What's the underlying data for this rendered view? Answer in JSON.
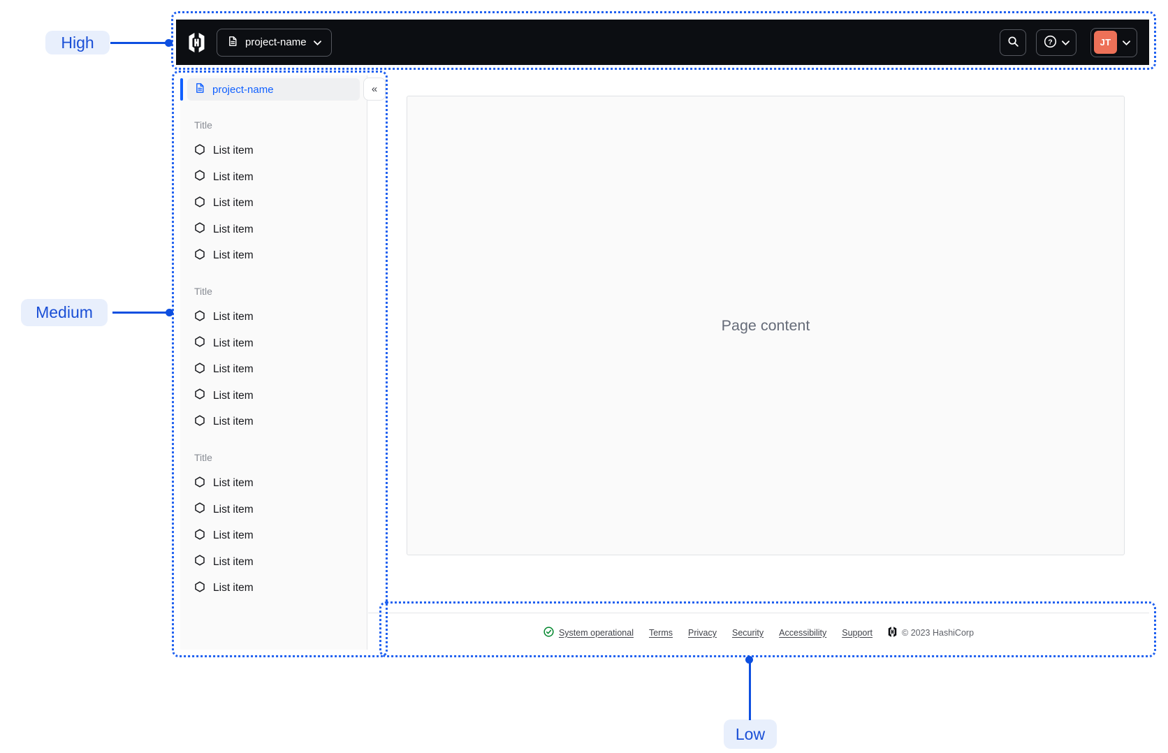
{
  "annotations": {
    "high": {
      "label": "High"
    },
    "medium": {
      "label": "Medium"
    },
    "low": {
      "label": "Low"
    }
  },
  "navbar": {
    "logo": "hashicorp-logo",
    "project_switcher": {
      "icon": "document-icon",
      "label": "project-name",
      "chevron": "chevron-down-icon"
    },
    "search_button": {
      "icon": "search-icon"
    },
    "help_menu": {
      "icon": "help-icon",
      "glyph": "?",
      "chevron": "chevron-down-icon"
    },
    "user_menu": {
      "avatar_initials": "JT",
      "chevron": "chevron-down-icon"
    }
  },
  "sidebar": {
    "header": {
      "icon": "document-icon",
      "label": "project-name"
    },
    "collapse_button": {
      "glyph": "«"
    },
    "sections": [
      {
        "title": "Title",
        "items": [
          "List item",
          "List item",
          "List item",
          "List item",
          "List item"
        ]
      },
      {
        "title": "Title",
        "items": [
          "List item",
          "List item",
          "List item",
          "List item",
          "List item"
        ]
      },
      {
        "title": "Title",
        "items": [
          "List item",
          "List item",
          "List item",
          "List item",
          "List item"
        ]
      }
    ]
  },
  "main": {
    "placeholder": "Page content"
  },
  "footer": {
    "status": {
      "icon": "check-circle-icon",
      "label": "System operational"
    },
    "links": [
      "Terms",
      "Privacy",
      "Security",
      "Accessibility",
      "Support"
    ],
    "copyright": "© 2023 HashiCorp"
  },
  "colors": {
    "annotation_blue": "#2061f0",
    "annotation_line_blue": "#0d4fe0",
    "annotation_label_bg": "#e8effc",
    "annotation_label_text": "#1a4fd6",
    "accent_blue": "#1060ff",
    "navbar_bg": "#0c0e12",
    "avatar_orange": "#ed7158",
    "success_green": "#00862c",
    "sidebar_bg": "#fafafa"
  }
}
